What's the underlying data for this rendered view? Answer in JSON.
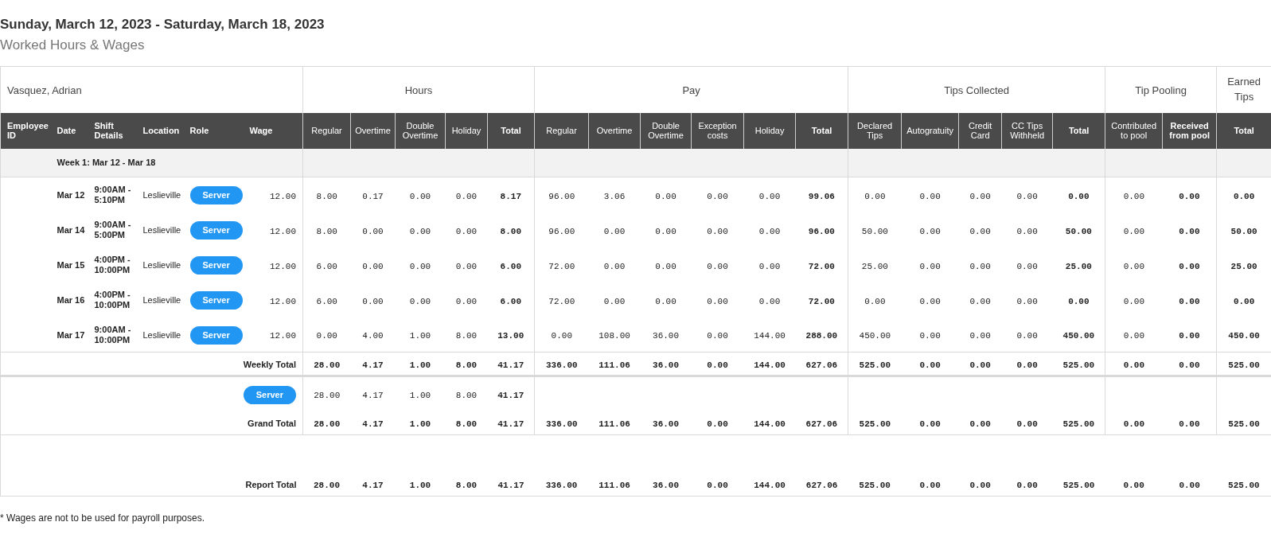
{
  "title": "Sunday, March 12, 2023 - Saturday, March 18, 2023",
  "subtitle": "Worked Hours & Wages",
  "employee": "Vasquez, Adrian",
  "left_columns": [
    "Employee ID",
    "Date",
    "Shift Details",
    "Location",
    "Role",
    "Wage"
  ],
  "groups": [
    {
      "label": "Hours",
      "columns": [
        {
          "label": "Regular",
          "bold": false
        },
        {
          "label": "Overtime",
          "bold": false
        },
        {
          "label": "Double Overtime",
          "bold": false
        },
        {
          "label": "Holiday",
          "bold": false
        },
        {
          "label": "Total",
          "bold": true
        }
      ]
    },
    {
      "label": "Pay",
      "columns": [
        {
          "label": "Regular",
          "bold": false
        },
        {
          "label": "Overtime",
          "bold": false
        },
        {
          "label": "Double Overtime",
          "bold": false
        },
        {
          "label": "Exception costs",
          "bold": false
        },
        {
          "label": "Holiday",
          "bold": false
        },
        {
          "label": "Total",
          "bold": true
        }
      ]
    },
    {
      "label": "Tips Collected",
      "columns": [
        {
          "label": "Declared Tips",
          "bold": false
        },
        {
          "label": "Autogratuity",
          "bold": false
        },
        {
          "label": "Credit Card",
          "bold": false
        },
        {
          "label": "CC Tips Withheld",
          "bold": false
        },
        {
          "label": "Total",
          "bold": true
        }
      ]
    },
    {
      "label": "Tip Pooling",
      "columns": [
        {
          "label": "Contributed to pool",
          "bold": false
        },
        {
          "label": "Received from pool",
          "bold": true
        }
      ]
    },
    {
      "label": "Earned Tips",
      "columns": [
        {
          "label": "Total",
          "bold": true
        }
      ]
    }
  ],
  "week_label": "Week 1: Mar 12 - Mar 18",
  "rows": [
    {
      "date": "Mar 12",
      "shift": "9:00AM - 5:10PM",
      "location": "Leslieville",
      "role": "Server",
      "wage": "12.00",
      "values": [
        "8.00",
        "0.17",
        "0.00",
        "0.00",
        "8.17",
        "96.00",
        "3.06",
        "0.00",
        "0.00",
        "0.00",
        "99.06",
        "0.00",
        "0.00",
        "0.00",
        "0.00",
        "0.00",
        "0.00",
        "0.00",
        "0.00"
      ]
    },
    {
      "date": "Mar 14",
      "shift": "9:00AM - 5:00PM",
      "location": "Leslieville",
      "role": "Server",
      "wage": "12.00",
      "values": [
        "8.00",
        "0.00",
        "0.00",
        "0.00",
        "8.00",
        "96.00",
        "0.00",
        "0.00",
        "0.00",
        "0.00",
        "96.00",
        "50.00",
        "0.00",
        "0.00",
        "0.00",
        "50.00",
        "0.00",
        "0.00",
        "50.00"
      ]
    },
    {
      "date": "Mar 15",
      "shift": "4:00PM - 10:00PM",
      "location": "Leslieville",
      "role": "Server",
      "wage": "12.00",
      "values": [
        "6.00",
        "0.00",
        "0.00",
        "0.00",
        "6.00",
        "72.00",
        "0.00",
        "0.00",
        "0.00",
        "0.00",
        "72.00",
        "25.00",
        "0.00",
        "0.00",
        "0.00",
        "25.00",
        "0.00",
        "0.00",
        "25.00"
      ]
    },
    {
      "date": "Mar 16",
      "shift": "4:00PM - 10:00PM",
      "location": "Leslieville",
      "role": "Server",
      "wage": "12.00",
      "values": [
        "6.00",
        "0.00",
        "0.00",
        "0.00",
        "6.00",
        "72.00",
        "0.00",
        "0.00",
        "0.00",
        "0.00",
        "72.00",
        "0.00",
        "0.00",
        "0.00",
        "0.00",
        "0.00",
        "0.00",
        "0.00",
        "0.00"
      ]
    },
    {
      "date": "Mar 17",
      "shift": "9:00AM - 10:00PM",
      "location": "Leslieville",
      "role": "Server",
      "wage": "12.00",
      "values": [
        "0.00",
        "4.00",
        "1.00",
        "8.00",
        "13.00",
        "0.00",
        "108.00",
        "36.00",
        "0.00",
        "144.00",
        "288.00",
        "450.00",
        "0.00",
        "0.00",
        "0.00",
        "450.00",
        "0.00",
        "0.00",
        "450.00"
      ]
    }
  ],
  "weekly_total": {
    "label": "Weekly Total",
    "values": [
      "28.00",
      "4.17",
      "1.00",
      "8.00",
      "41.17",
      "336.00",
      "111.06",
      "36.00",
      "0.00",
      "144.00",
      "627.06",
      "525.00",
      "0.00",
      "0.00",
      "0.00",
      "525.00",
      "0.00",
      "0.00",
      "525.00"
    ]
  },
  "role_summary": {
    "role": "Server",
    "values": [
      "28.00",
      "4.17",
      "1.00",
      "8.00",
      "41.17"
    ]
  },
  "grand_total": {
    "label": "Grand Total",
    "values": [
      "28.00",
      "4.17",
      "1.00",
      "8.00",
      "41.17",
      "336.00",
      "111.06",
      "36.00",
      "0.00",
      "144.00",
      "627.06",
      "525.00",
      "0.00",
      "0.00",
      "0.00",
      "525.00",
      "0.00",
      "0.00",
      "525.00"
    ]
  },
  "report_total": {
    "label": "Report Total",
    "values": [
      "28.00",
      "4.17",
      "1.00",
      "8.00",
      "41.17",
      "336.00",
      "111.06",
      "36.00",
      "0.00",
      "144.00",
      "627.06",
      "525.00",
      "0.00",
      "0.00",
      "0.00",
      "525.00",
      "0.00",
      "0.00",
      "525.00"
    ]
  },
  "footnote": "* Wages are not to be used for payroll purposes."
}
